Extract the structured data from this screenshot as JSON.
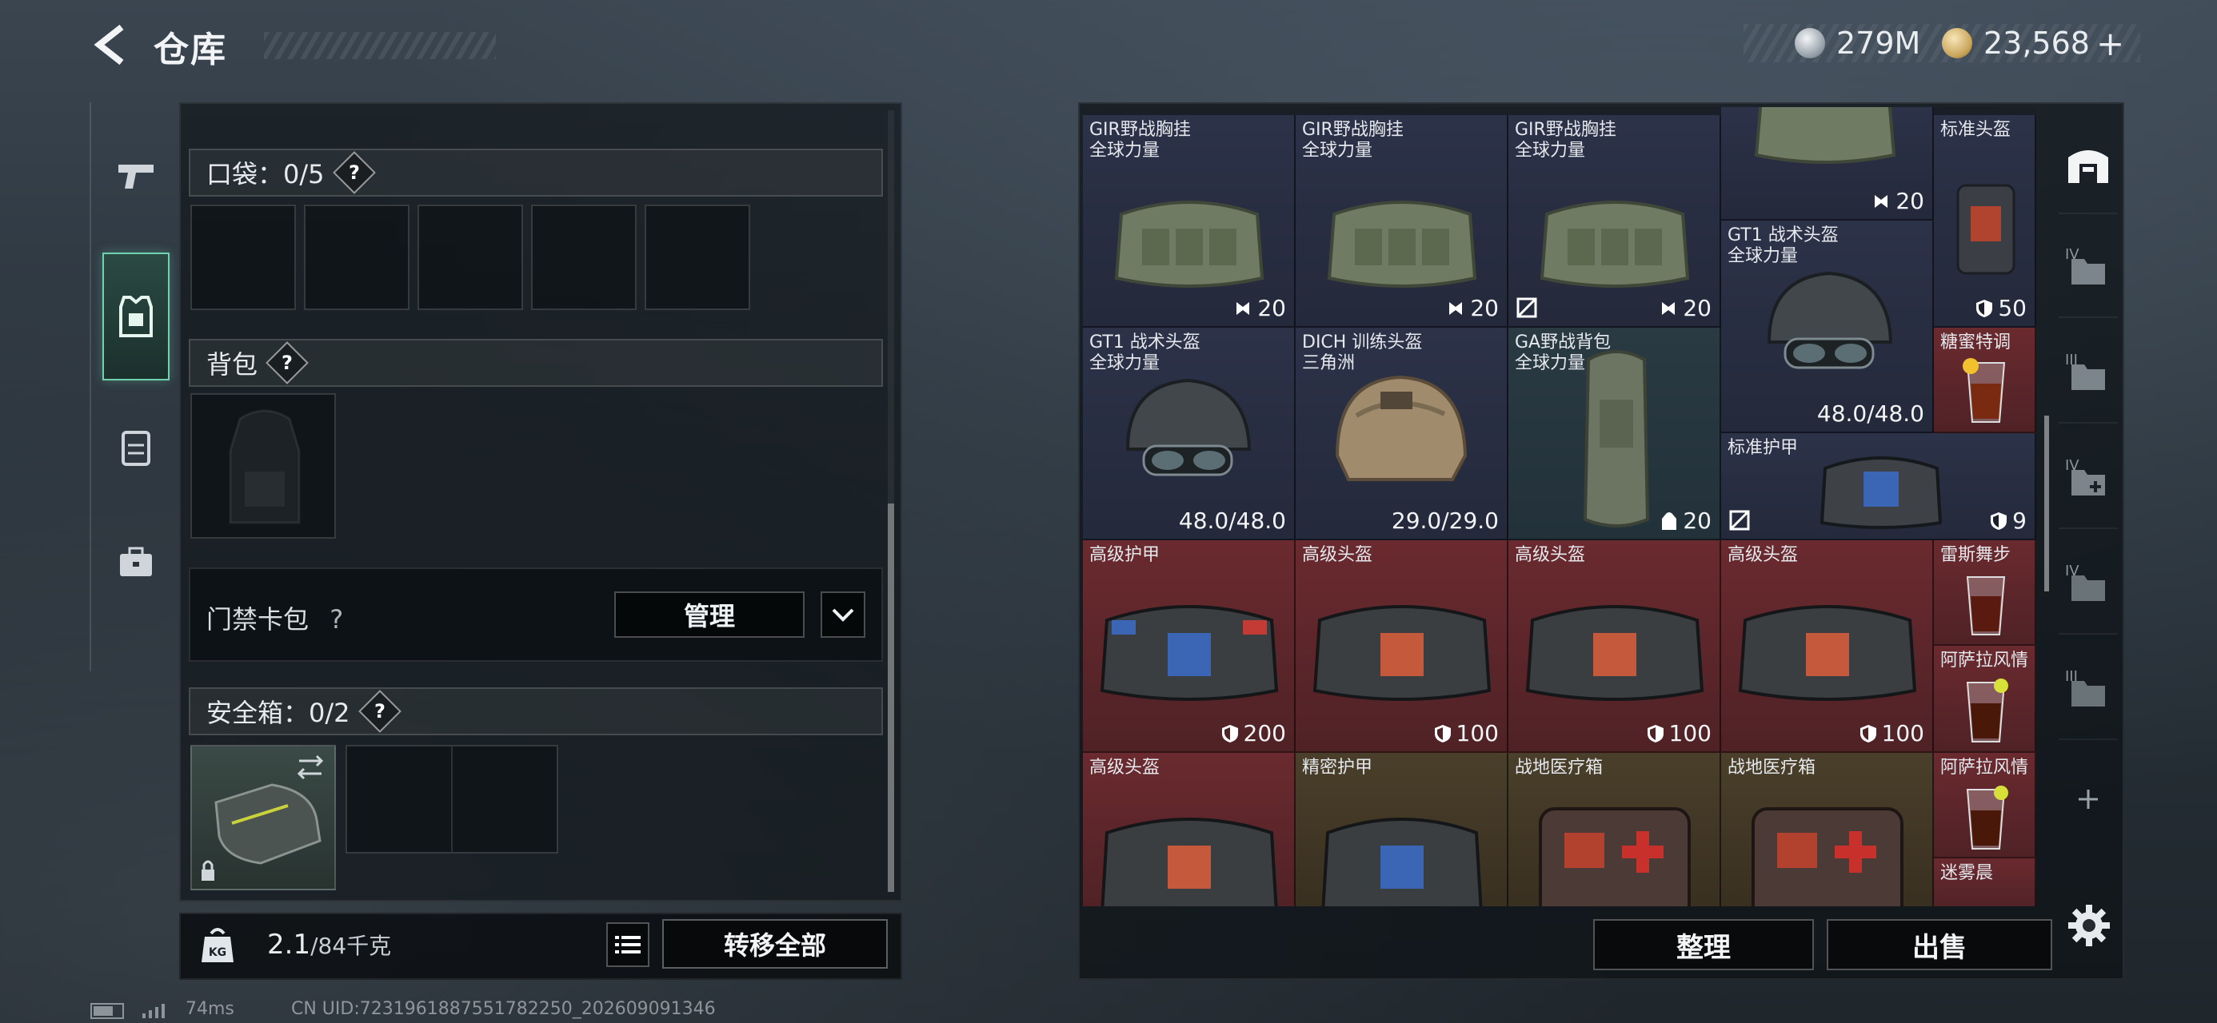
{
  "header": {
    "title": "仓库"
  },
  "currency": {
    "silver": "279M",
    "gold": "23,568",
    "plus": "+"
  },
  "left_panel": {
    "pockets_label": "口袋：0/5",
    "backpack_label": "背包",
    "keycard_label": "门禁卡包",
    "manage_label": "管理",
    "safe_label": "安全箱：0/2",
    "help_glyph": "?"
  },
  "weight": {
    "current": "2.1",
    "max": "/84千克",
    "kg_badge": "KG"
  },
  "buttons": {
    "transfer_all": "转移全部",
    "sort": "整理",
    "sell": "出售"
  },
  "stash": {
    "items": [
      {
        "name": "GIR野战胸挂\n全球力量",
        "value": "20",
        "value_icon": "bag-rig-icon",
        "tile": "navy"
      },
      {
        "name": "GIR野战胸挂\n全球力量",
        "value": "20",
        "value_icon": "bag-rig-icon",
        "tile": "navy"
      },
      {
        "name": "GIR野战胸挂\n全球力量",
        "value": "20",
        "value_icon": "bag-rig-icon",
        "tile": "navy"
      },
      {
        "name": "",
        "value": "20",
        "value_icon": "bag-rig-icon",
        "tile": "navy"
      },
      {
        "name": "标准头盔",
        "value": "50",
        "value_icon": "shield-icon",
        "tile": "navy"
      },
      {
        "name": "GT1 战术头盔\n全球力量",
        "value": "48.0/48.0",
        "value_icon": "",
        "tile": "navy"
      },
      {
        "name": "GT1 战术头盔\n全球力量",
        "value": "48.0/48.0",
        "value_icon": "",
        "tile": "navy"
      },
      {
        "name": "DICH 训练头盔\n三角洲",
        "value": "29.0/29.0",
        "value_icon": "",
        "tile": "navy"
      },
      {
        "name": "GA野战背包\n全球力量",
        "value": "20",
        "value_icon": "backpack-icon",
        "tile": "teal"
      },
      {
        "name": "糖蜜特调",
        "value": "",
        "value_icon": "",
        "tile": "red"
      },
      {
        "name": "标准护甲",
        "value": "9",
        "value_icon": "shield-icon",
        "tile": "navy"
      },
      {
        "name": "高级护甲",
        "value": "200",
        "value_icon": "shield-icon",
        "tile": "red"
      },
      {
        "name": "高级头盔",
        "value": "100",
        "value_icon": "shield-icon",
        "tile": "red"
      },
      {
        "name": "高级头盔",
        "value": "100",
        "value_icon": "shield-icon",
        "tile": "red"
      },
      {
        "name": "高级头盔",
        "value": "100",
        "value_icon": "shield-icon",
        "tile": "red"
      },
      {
        "name": "雷斯舞步",
        "value": "",
        "value_icon": "",
        "tile": "red"
      },
      {
        "name": "阿萨拉风情",
        "value": "",
        "value_icon": "",
        "tile": "red"
      },
      {
        "name": "高级头盔",
        "value": "",
        "value_icon": "",
        "tile": "red"
      },
      {
        "name": "精密护甲",
        "value": "",
        "value_icon": "",
        "tile": "gold"
      },
      {
        "name": "战地医疗箱",
        "value": "",
        "value_icon": "",
        "tile": "gold"
      },
      {
        "name": "战地医疗箱",
        "value": "",
        "value_icon": "",
        "tile": "gold"
      },
      {
        "name": "阿萨拉风情",
        "value": "",
        "value_icon": "",
        "tile": "red"
      },
      {
        "name": "迷雾晨",
        "value": "",
        "value_icon": "",
        "tile": "red"
      }
    ]
  },
  "stash_tabs": [
    "IV",
    "III",
    "IV",
    "IV",
    "III"
  ],
  "status_bar": {
    "ping": "74ms",
    "uid": "CN UID:7231961887551782250_202609091346"
  },
  "colors": {
    "accent": "#6fd3b0",
    "rare_red": "#6a2a2f",
    "common_navy": "#2c3248",
    "gold_tile": "#4a3f2a"
  }
}
